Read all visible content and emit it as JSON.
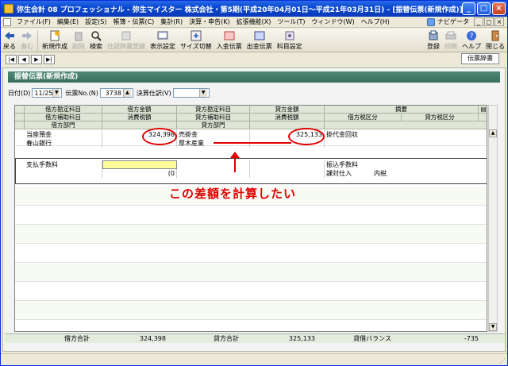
{
  "window": {
    "title": "弥生会計 08 プロフェッショナル - 弥生マイスター 株式会社・第5期(平成20年04月01日～平成21年03月31日) - [振替伝票(新規作成)]",
    "minimize": "_",
    "maximize": "□",
    "close": "×"
  },
  "menu": {
    "items": [
      "ファイル(F)",
      "編集(E)",
      "設定(S)",
      "帳簿・伝票(C)",
      "集計(R)",
      "決算・申告(K)",
      "拡張機能(X)",
      "ツール(T)",
      "ウィンドウ(W)",
      "ヘルプ(H)"
    ],
    "navi": "ナビゲータ"
  },
  "toolbar": {
    "back": "戻る",
    "forward": "進む",
    "new": "新規作成",
    "delete": "削除",
    "search": "検索",
    "disabled_btn": "仕訳辞書登録",
    "display_settings": "表示設定",
    "size_switch": "サイズ切替",
    "deposit_slip": "入金伝票",
    "payment_slip": "出金伝票",
    "account_settings": "科目設定",
    "register": "登録",
    "print": "印刷",
    "help": "ヘルプ",
    "close": "閉じる"
  },
  "nav": {
    "first": "|◀",
    "prev": "◀",
    "next": "▶",
    "last": "▶|",
    "dictionary": "伝票辞書"
  },
  "form": {
    "header": "振替伝票(新規作成)",
    "date_label": "日付(D)",
    "date_value": "11/25",
    "slip_no_label": "伝票No.(N)",
    "slip_no_value": "3738",
    "closing_label": "決算仕訳(V)",
    "closing_value": ""
  },
  "grid": {
    "header_row1": [
      "借方勘定科目",
      "借方金額",
      "貸方勘定科目",
      "貸方金額",
      "摘要"
    ],
    "header_row2": [
      "借方補助科目",
      "消費税額",
      "貸方補助科目",
      "消費税額",
      "借方税区分",
      "貸方税区分"
    ],
    "header_row3": [
      "借方部門",
      "貸方部門"
    ],
    "rows": [
      {
        "debit_account": "当座預金",
        "debit_amount": "324,398",
        "credit_account": "売掛金",
        "credit_amount": "325,133",
        "memo": "掛代金回収",
        "debit_sub": "春山銀行",
        "credit_sub": "厚木産業"
      },
      {
        "debit_account": "支払手数料",
        "debit_amount": "",
        "debit_tax": "(0",
        "memo": "振込手数料",
        "debit_tax_class": "課対仕入",
        "credit_tax_class": "内税"
      }
    ]
  },
  "totals": {
    "debit_label": "借方合計",
    "debit_total": "324,398",
    "credit_label": "貸方合計",
    "credit_total": "325,133",
    "balance_label": "貸借バランス",
    "balance_value": "-735"
  },
  "annotation": {
    "text": "この差額を計算したい",
    "color": "#e00000"
  },
  "colors": {
    "header_bar": "#3a6e5c",
    "grid_header": "#dfe6d8",
    "active_cell": "#ffff99"
  }
}
